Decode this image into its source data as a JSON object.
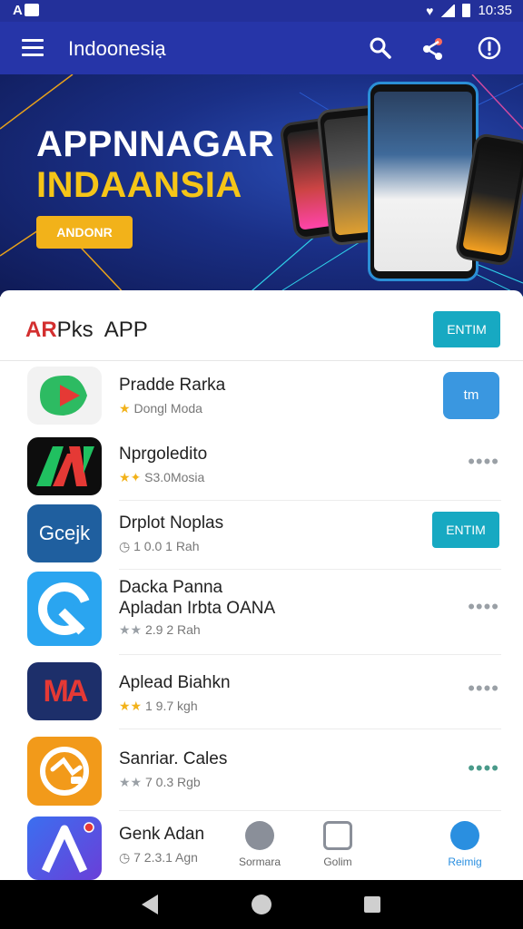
{
  "status_bar": {
    "left_label": "A",
    "time": "10:35"
  },
  "app_bar": {
    "title": "Indoonesiạ"
  },
  "banner": {
    "line1": "APPNNAGAR",
    "line2": "INDAANSIA",
    "button": "ANDONR"
  },
  "section": {
    "title_prefix": "AR",
    "title_mid": "Pks",
    "title_suffix": "APP",
    "header_button": "ENTIM"
  },
  "apps": [
    {
      "name": "Pradde Rarka",
      "meta": "Dongl Moda",
      "action": "tm",
      "rating_icon": "star"
    },
    {
      "name": "Nprgoledito",
      "meta": "S3.0Mosia",
      "action": "••••",
      "rating_icon": "stars"
    },
    {
      "name": "Drplot Noplas",
      "meta": "1 0.0 1 Rah",
      "action": "ENTIM",
      "rating_icon": "clock",
      "icon_text": "Gcejk"
    },
    {
      "name": "Dacka Panna",
      "name2": "Apladan Irbta OANA",
      "meta": "2.9 2 Rah",
      "action": "••••",
      "rating_icon": "stars-gray"
    },
    {
      "name": "Aplead Biahkn",
      "meta": "1 9.7 kgh",
      "action": "••••",
      "rating_icon": "stars",
      "icon_text": "MA"
    },
    {
      "name": "Sanriar. Cales",
      "meta": "7 0.3 Rgb",
      "action": "••••",
      "rating_icon": "stars-gray"
    },
    {
      "name": "Genk Adan",
      "meta": "7 2.3.1 Agn",
      "rating_icon": "clock"
    }
  ],
  "tabs": [
    {
      "label": "Sormara",
      "icon": "house-icon"
    },
    {
      "label": "Golim",
      "icon": "clipboard-icon"
    },
    {
      "label": "Reimig",
      "icon": "compass-icon"
    }
  ],
  "colors": {
    "primary": "#2635a8",
    "accent_yellow": "#f2b21a",
    "teal": "#17a9c2",
    "blue": "#3a97e0"
  }
}
